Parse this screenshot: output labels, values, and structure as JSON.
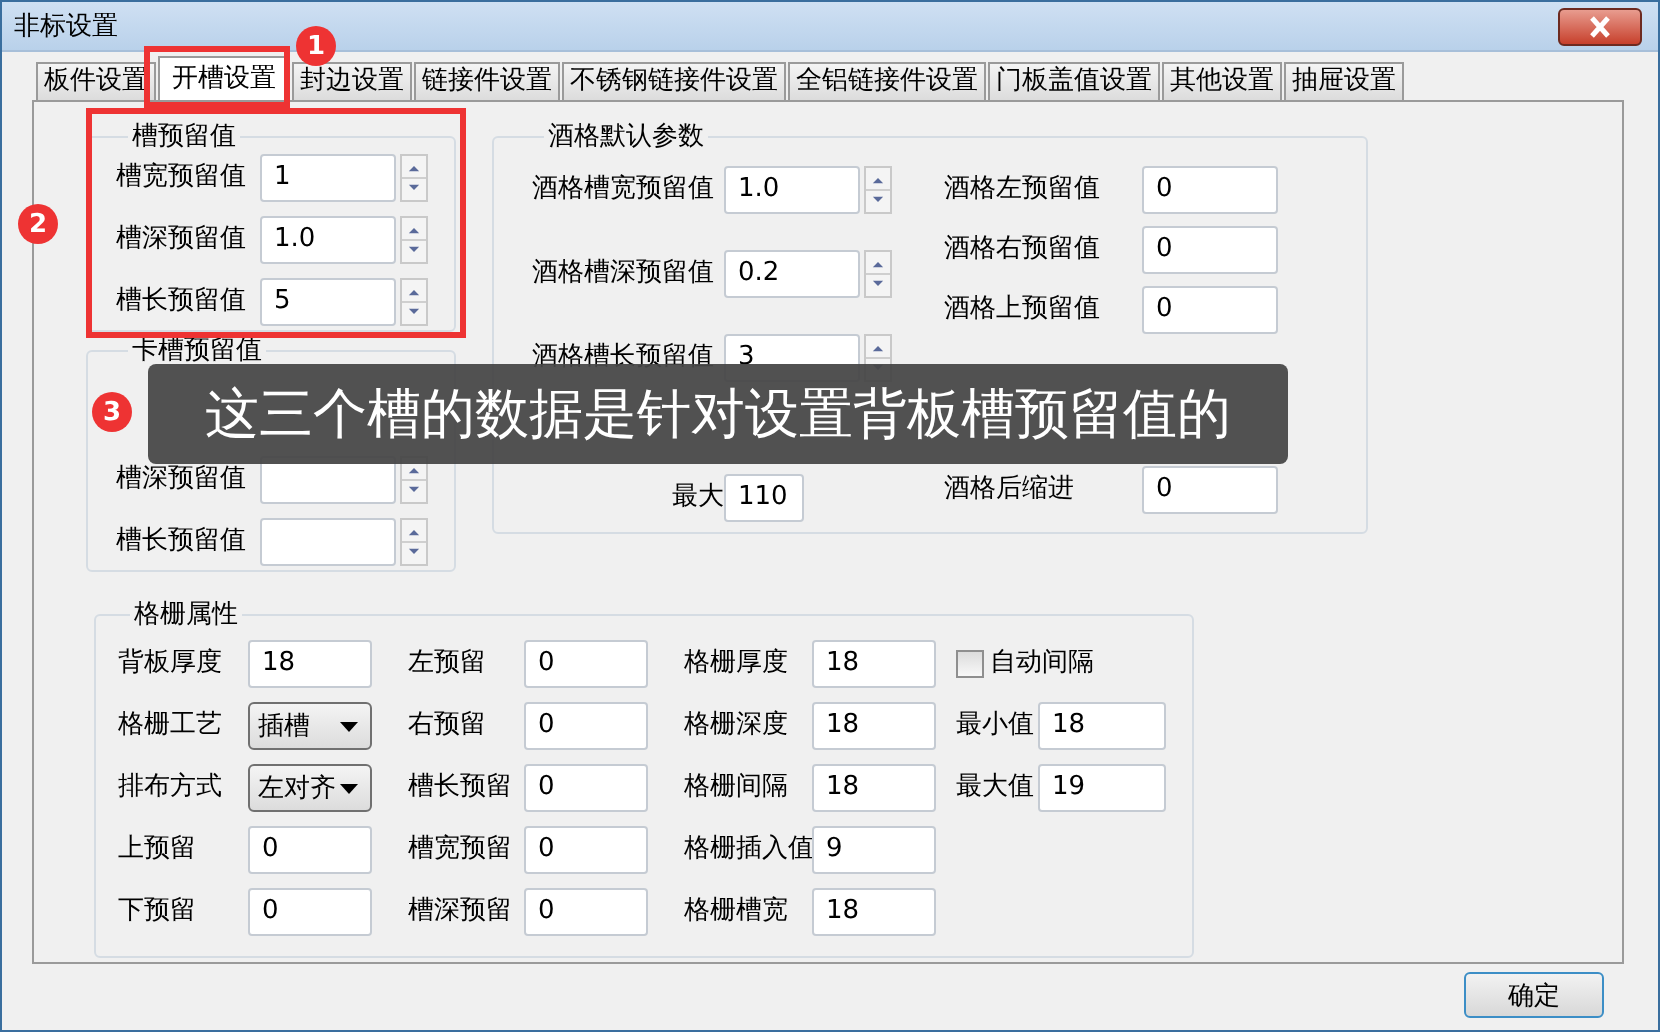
{
  "window": {
    "title": "非标设置"
  },
  "tabs": [
    {
      "label": "板件设置",
      "selected": false
    },
    {
      "label": "开槽设置",
      "selected": true
    },
    {
      "label": "封边设置",
      "selected": false
    },
    {
      "label": "链接件设置",
      "selected": false
    },
    {
      "label": "不锈钢链接件设置",
      "selected": false
    },
    {
      "label": "全铝链接件设置",
      "selected": false
    },
    {
      "label": "门板盖值设置",
      "selected": false
    },
    {
      "label": "其他设置",
      "selected": false
    },
    {
      "label": "抽屉设置",
      "selected": false
    }
  ],
  "slot_reserve": {
    "title": "槽预留值",
    "fields": [
      {
        "label": "槽宽预留值",
        "value": "1"
      },
      {
        "label": "槽深预留值",
        "value": "1.0"
      },
      {
        "label": "槽长预留值",
        "value": "5"
      }
    ]
  },
  "card_slot_reserve": {
    "title": "卡槽预留值",
    "fields": [
      {
        "kind": "covered"
      },
      {
        "kind": "field",
        "label": "槽深预留值"
      },
      {
        "kind": "field",
        "label": "槽长预留值"
      }
    ]
  },
  "wine_rack_defaults": {
    "title": "酒格默认参数",
    "spin_fields": [
      {
        "label": "酒格槽宽预留值",
        "value": "1.0"
      },
      {
        "label": "酒格槽深预留值",
        "value": "0.2"
      },
      {
        "label": "酒格槽长预留值",
        "value": "3"
      }
    ],
    "inner_diameter": {
      "max_label": "最大",
      "max_value": "110"
    },
    "right_fields": [
      {
        "kind": "field",
        "label": "酒格左预留值",
        "value": "0"
      },
      {
        "kind": "field",
        "label": "酒格右预留值",
        "value": "0"
      },
      {
        "kind": "field",
        "label": "酒格上预留值",
        "value": "0"
      },
      {
        "kind": "covered"
      },
      {
        "kind": "covered"
      },
      {
        "kind": "field",
        "label": "酒格后缩进",
        "value": "0"
      }
    ]
  },
  "grid_properties": {
    "title": "格栅属性",
    "columns": [
      [
        {
          "kind": "text",
          "label": "背板厚度",
          "value": "18"
        },
        {
          "kind": "dropdown",
          "label": "格栅工艺",
          "value": "插槽"
        },
        {
          "kind": "dropdown",
          "label": "排布方式",
          "value": "左对齐"
        },
        {
          "kind": "text",
          "label": "上预留",
          "value": "0"
        },
        {
          "kind": "text",
          "label": "下预留",
          "value": "0"
        }
      ],
      [
        {
          "kind": "text",
          "label": "左预留",
          "value": "0"
        },
        {
          "kind": "text",
          "label": "右预留",
          "value": "0"
        },
        {
          "kind": "text",
          "label": "槽长预留",
          "value": "0"
        },
        {
          "kind": "text",
          "label": "槽宽预留",
          "value": "0"
        },
        {
          "kind": "text",
          "label": "槽深预留",
          "value": "0"
        }
      ],
      [
        {
          "kind": "text",
          "label": "格栅厚度",
          "value": "18"
        },
        {
          "kind": "text",
          "label": "格栅深度",
          "value": "18"
        },
        {
          "kind": "text",
          "label": "格栅间隔",
          "value": "18"
        },
        {
          "kind": "text",
          "label": "格栅插入值",
          "value": "9"
        },
        {
          "kind": "text",
          "label": "格栅槽宽",
          "value": "18"
        }
      ],
      [
        {
          "kind": "checkbox",
          "label": "自动间隔",
          "checked": false
        },
        {
          "kind": "text",
          "label": "最小值",
          "value": "18"
        },
        {
          "kind": "text",
          "label": "最大值",
          "value": "19"
        }
      ]
    ]
  },
  "ok_button": "确定",
  "annotations": {
    "badges": [
      "1",
      "2",
      "3"
    ],
    "caption": "这三个槽的数据是针对设置背板槽预留值的"
  }
}
